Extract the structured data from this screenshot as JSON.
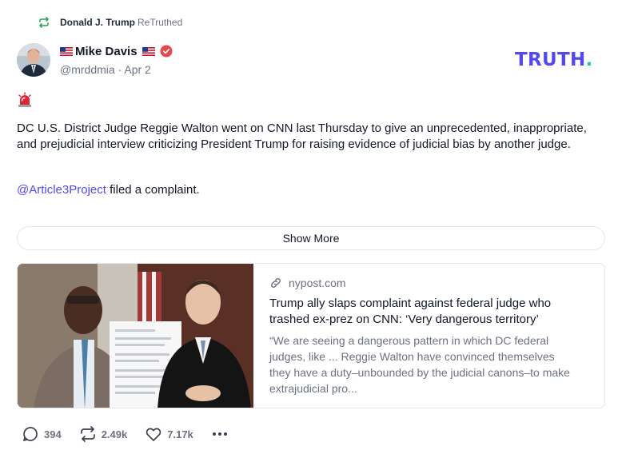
{
  "retruth": {
    "user": "Donald J. Trump",
    "action": "ReTruthed",
    "icon": "retruth-icon"
  },
  "author": {
    "name": "Mike Davis",
    "handle": "@mrddmia",
    "separator": "·",
    "date": "Apr 2",
    "flag_icon": "us-flag-icon",
    "verified_icon": "verified-badge-icon"
  },
  "brand": {
    "text": "TRUTH",
    "dot": ".",
    "color": "#5448ee",
    "dot_color": "#17c7b9"
  },
  "post": {
    "emoji_icon": "siren-icon",
    "paragraph1": "DC U.S. District Judge Reggie Walton went on CNN last Thursday to give an unprecedented, inappropriate, and prejudicial interview criticizing President Trump for raising evidence of judicial bias by another judge.",
    "mention": "@Article3Project",
    "paragraph2_rest": " filed a complaint.",
    "show_more": "Show More"
  },
  "link_card": {
    "domain": "nypost.com",
    "title": "Trump ally slaps complaint against federal judge who trashed ex-prez on CNN: ‘Very dangerous territory’",
    "description": "“We are seeing a dangerous pattern in which DC federal judges, like ... Reggie Walton have convinced themselves they have a duty–unbounded by the judicial canons–to make extrajudicial pro..."
  },
  "actions": {
    "replies": "394",
    "retruths": "2.49k",
    "likes": "7.17k"
  }
}
